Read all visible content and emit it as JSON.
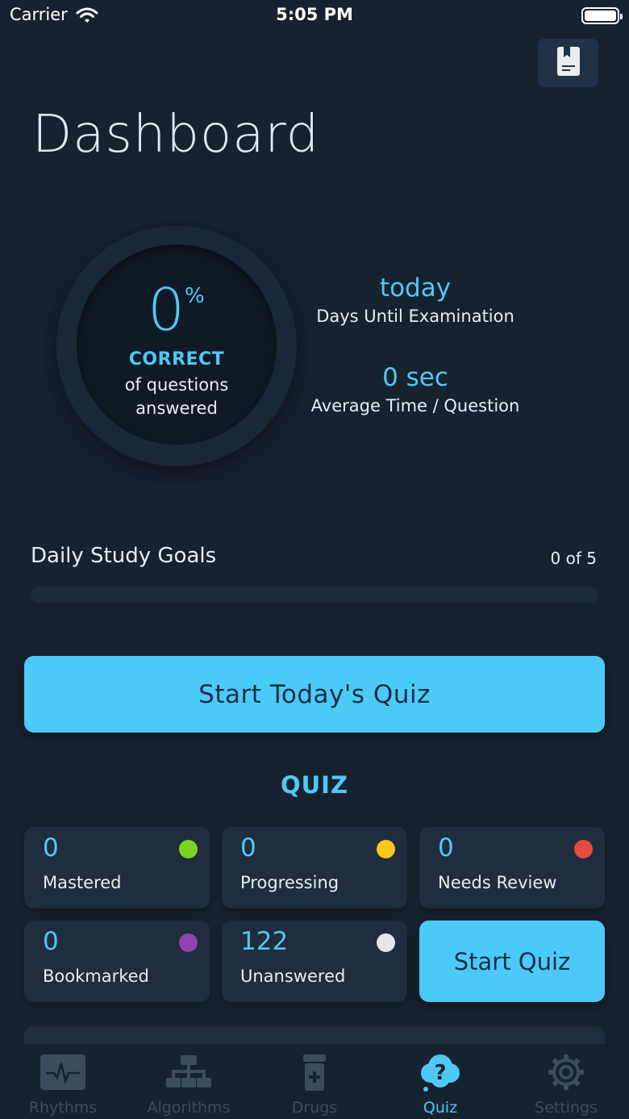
{
  "status_bar": {
    "carrier": "Carrier",
    "time": "5:05 PM"
  },
  "page_title": "Dashboard",
  "progress": {
    "percent_value": "0",
    "percent_sign": "%",
    "percent_fraction": 0,
    "correct_label": "CORRECT",
    "caption_line1": "of questions",
    "caption_line2": "answered"
  },
  "stats": {
    "days_value": "today",
    "days_label": "Days Until Examination",
    "time_value": "0 sec",
    "time_label": "Average Time / Question"
  },
  "daily_goals": {
    "title": "Daily Study Goals",
    "count": "0 of 5",
    "completed": 0,
    "total": 5
  },
  "start_today_label": "Start Today's Quiz",
  "quiz_heading": "QUIZ",
  "quiz_cards": [
    {
      "count": "0",
      "label": "Mastered",
      "dot_color": "#7ed321"
    },
    {
      "count": "0",
      "label": "Progressing",
      "dot_color": "#f8c81c"
    },
    {
      "count": "0",
      "label": "Needs Review",
      "dot_color": "#e74c3c"
    },
    {
      "count": "0",
      "label": "Bookmarked",
      "dot_color": "#8e44ad"
    },
    {
      "count": "122",
      "label": "Unanswered",
      "dot_color": "#e3e6ea"
    }
  ],
  "start_quiz_label": "Start Quiz",
  "tabs": [
    {
      "label": "Rhythms",
      "icon": "ecg-icon",
      "active": false
    },
    {
      "label": "Algorithms",
      "icon": "flowchart-icon",
      "active": false
    },
    {
      "label": "Drugs",
      "icon": "pill-bottle-icon",
      "active": false
    },
    {
      "label": "Quiz",
      "icon": "question-bubble-icon",
      "active": true
    },
    {
      "label": "Settings",
      "icon": "gear-icon",
      "active": false
    }
  ],
  "colors": {
    "accent": "#4ec9f5",
    "background": "#172230",
    "card": "#1f2d3e",
    "inactive_tab": "#3c4b5d"
  }
}
